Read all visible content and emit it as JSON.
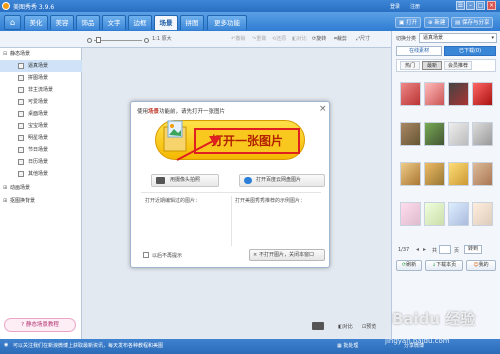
{
  "app": {
    "title": "美图秀秀 3.9.6",
    "login_label": "登录",
    "register_label": "注册"
  },
  "menu": {
    "tabs": [
      "美化",
      "美容",
      "饰品",
      "文字",
      "边框",
      "场景",
      "拼图"
    ],
    "more_label": "更多功能",
    "open_label": "打开",
    "new_label": "新建",
    "save_label": "保存与分享"
  },
  "toolbar": {
    "zoom_label": "1:1 原大",
    "undo": "撤销",
    "redo": "重做",
    "reset": "还原",
    "compare": "对比",
    "rotate": "旋转",
    "crop": "裁剪",
    "size": "尺寸"
  },
  "left_panel": {
    "items": [
      {
        "label": "静态场景",
        "type": "head"
      },
      {
        "label": "逼真场景",
        "type": "sub",
        "selected": true
      },
      {
        "label": "拼图场景",
        "type": "sub"
      },
      {
        "label": "非主流场景",
        "type": "sub"
      },
      {
        "label": "可爱场景",
        "type": "sub"
      },
      {
        "label": "桌面场景",
        "type": "sub"
      },
      {
        "label": "宝宝场景",
        "type": "sub"
      },
      {
        "label": "明星场景",
        "type": "sub"
      },
      {
        "label": "节日场景",
        "type": "sub"
      },
      {
        "label": "日历场景",
        "type": "sub"
      },
      {
        "label": "其他场景",
        "type": "sub"
      },
      {
        "label": "动画场景",
        "type": "head"
      },
      {
        "label": "抠图换背景",
        "type": "head"
      }
    ],
    "tutorial_label": "静态场景教程"
  },
  "dialog": {
    "hint_prefix": "使用",
    "hint_highlight": "场景",
    "hint_suffix": "功能前，请先打开一张图片",
    "open_button": "打开一张图片",
    "camera_button": "用摄像头拍照",
    "cloud_button": "打开百度云网盘图片",
    "recent_left": "打开近期编辑过的图片：",
    "recent_right": "打开美图秀秀推荐的示例图片：",
    "no_show_label": "以后不再提示",
    "cancel_button": "不打开图片，关闭本窗口"
  },
  "right_panel": {
    "category_label": "切换分类",
    "category_value": "逼真场景",
    "tabs": [
      "在线素材",
      "已下载(0)"
    ],
    "subtabs": [
      "热门",
      "最新",
      "会员推荐"
    ],
    "page_text": "1/37",
    "page_of": "共",
    "page_unit": "页",
    "go_label": "转到",
    "refresh_label": "刷新",
    "download_label": "下载本页",
    "my_label": "我的"
  },
  "canvas": {
    "compare_label": "对比",
    "preview_label": "预览"
  },
  "status": {
    "text": "可以关注我们在新浪微博上获取最新资讯，每天发布各种教程和美图",
    "batch_label": "批处理",
    "share_label": "分享微博"
  },
  "watermark": {
    "text": "jingyan.baidu.com",
    "logo_text": "Baidu 经验"
  },
  "colors": {
    "accent_red": "#e02020",
    "open_btn_orange": "#f5b800",
    "brand_blue": "#2f7cd2"
  }
}
